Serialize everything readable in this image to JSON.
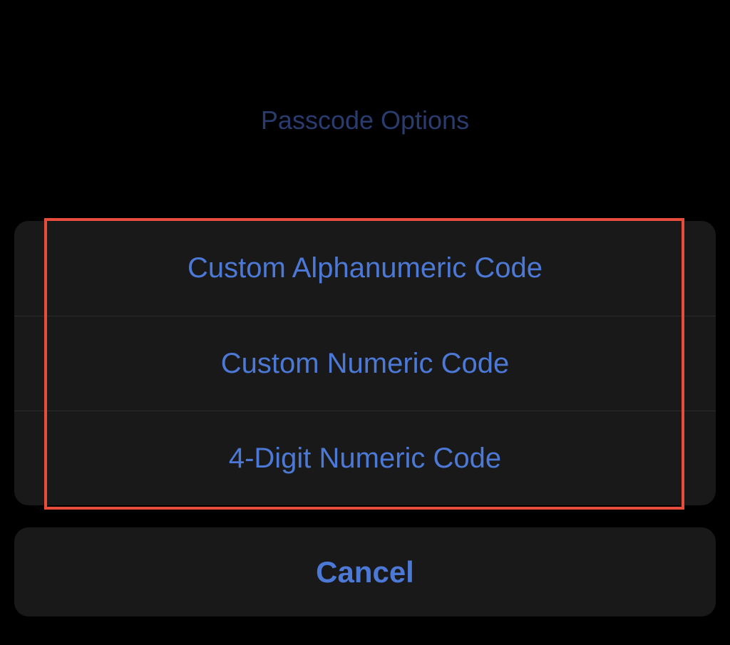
{
  "title": "Passcode Options",
  "options": {
    "alphanumeric": "Custom Alphanumeric Code",
    "numeric": "Custom Numeric Code",
    "four_digit": "4-Digit Numeric Code"
  },
  "cancel": "Cancel"
}
